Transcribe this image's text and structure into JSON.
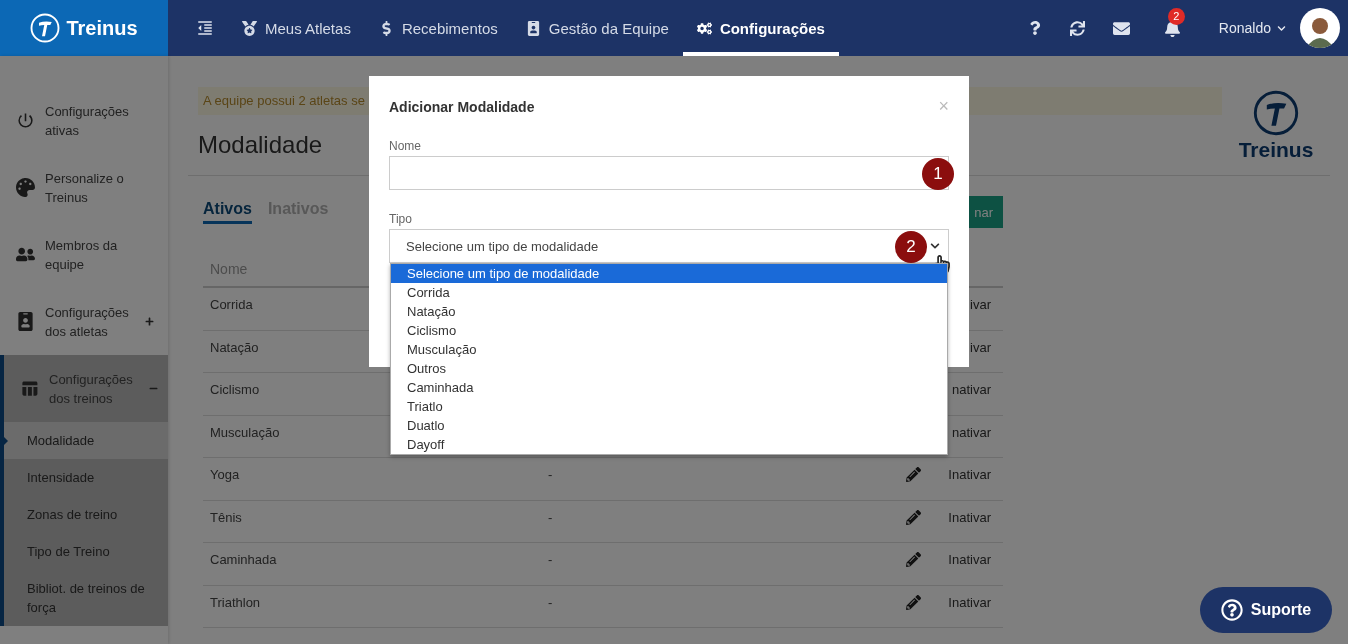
{
  "topbar": {
    "brand": "Treinus",
    "nav": [
      {
        "label": "Meus Atletas",
        "selected": false
      },
      {
        "label": "Recebimentos",
        "selected": false
      },
      {
        "label": "Gestão da Equipe",
        "selected": false
      },
      {
        "label": "Configurações",
        "selected": true
      }
    ],
    "notification_count": "2",
    "user": "Ronaldo"
  },
  "sidebar": {
    "items": [
      {
        "kind": "link",
        "label": "Configurações ativas"
      },
      {
        "kind": "link",
        "label": "Personalize o Treinus"
      },
      {
        "kind": "link",
        "label": "Membros da equipe"
      },
      {
        "kind": "group",
        "label": "Configurações dos atletas",
        "expanded": false
      },
      {
        "kind": "group",
        "label": "Configurações dos treinos",
        "expanded": true,
        "children": [
          {
            "label": "Modalidade",
            "selected": true
          },
          {
            "label": "Intensidade",
            "selected": false
          },
          {
            "label": "Zonas de treino",
            "selected": false
          },
          {
            "label": "Tipo de Treino",
            "selected": false
          },
          {
            "label": "Bibliot. de treinos de força",
            "selected": false
          }
        ]
      }
    ]
  },
  "page": {
    "alert": "A equipe possui 2 atletas se",
    "brand": "Treinus",
    "title": "Modalidade",
    "tabs": [
      {
        "label": "Ativos",
        "selected": true
      },
      {
        "label": "Inativos",
        "selected": false
      }
    ],
    "add_button": "nar",
    "table": {
      "columns": [
        "Nome"
      ],
      "rows": [
        {
          "name": "Corrida",
          "action": "ivar"
        },
        {
          "name": "Natação",
          "action": "ivar"
        },
        {
          "name": "Ciclismo",
          "action": "nativar"
        },
        {
          "name": "Musculação",
          "action": "nativar"
        },
        {
          "name": "Yoga",
          "detail": "-",
          "action": "Inativar"
        },
        {
          "name": "Tênis",
          "detail": "-",
          "action": "Inativar"
        },
        {
          "name": "Caminhada",
          "detail": "-",
          "action": "Inativar"
        },
        {
          "name": "Triathlon",
          "detail": "-",
          "action": "Inativar"
        }
      ]
    }
  },
  "modal": {
    "title": "Adicionar Modalidade",
    "close": "×",
    "fields": [
      {
        "kind": "text",
        "label": "Nome",
        "marker": "1"
      },
      {
        "kind": "select",
        "label": "Tipo",
        "value": "Selecione um tipo de modalidade",
        "expanded": true,
        "marker": "2",
        "options": [
          {
            "label": "Selecione um tipo de modalidade",
            "selected": true
          },
          {
            "label": "Corrida",
            "selected": false
          },
          {
            "label": "Natação",
            "selected": false
          },
          {
            "label": "Ciclismo",
            "selected": false
          },
          {
            "label": "Musculação",
            "selected": false
          },
          {
            "label": "Outros",
            "selected": false
          },
          {
            "label": "Caminhada",
            "selected": false
          },
          {
            "label": "Triatlo",
            "selected": false
          },
          {
            "label": "Duatlo",
            "selected": false
          },
          {
            "label": "Dayoff",
            "selected": false
          }
        ]
      }
    ]
  },
  "support_button": "Suporte"
}
